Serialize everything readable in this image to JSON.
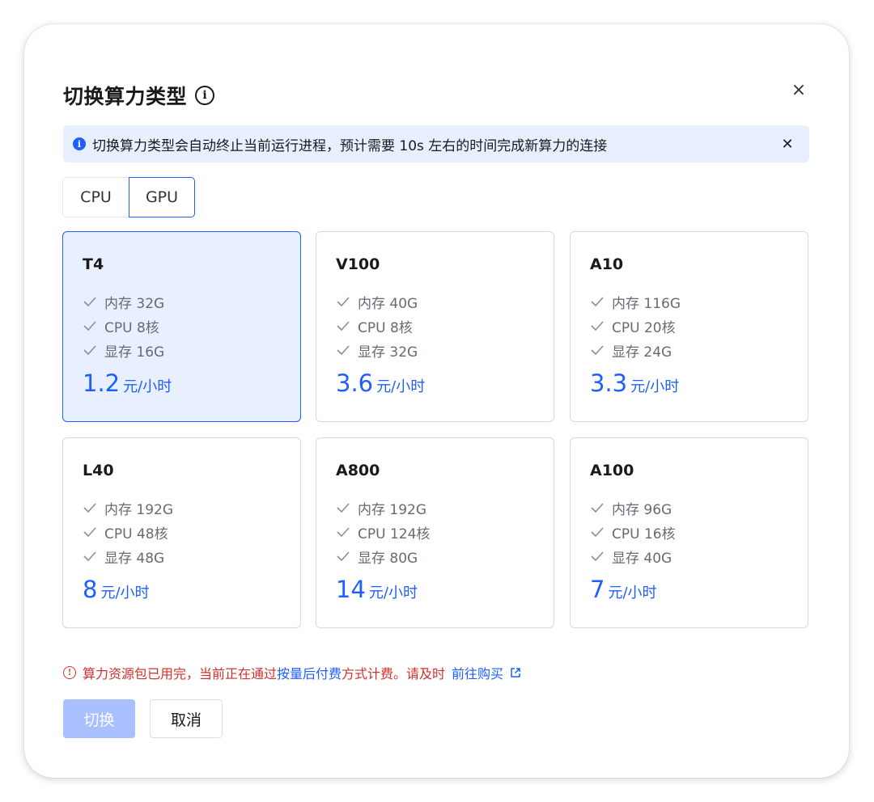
{
  "dialog": {
    "title": "切换算力类型",
    "info_glyph": "i",
    "close_glyph": "×"
  },
  "notice": {
    "icon_glyph": "i",
    "text": "切换算力类型会自动终止当前运行进程，预计需要 10s 左右的时间完成新算力的连接",
    "close_glyph": "✕"
  },
  "tabs": [
    {
      "label": "CPU",
      "active": false
    },
    {
      "label": "GPU",
      "active": true
    }
  ],
  "cards": [
    {
      "name": "T4",
      "specs": [
        "内存 32G",
        "CPU 8核",
        "显存 16G"
      ],
      "price": "1.2",
      "unit": "元/小时",
      "selected": true
    },
    {
      "name": "V100",
      "specs": [
        "内存 40G",
        "CPU 8核",
        "显存 32G"
      ],
      "price": "3.6",
      "unit": "元/小时",
      "selected": false
    },
    {
      "name": "A10",
      "specs": [
        "内存 116G",
        "CPU 20核",
        "显存 24G"
      ],
      "price": "3.3",
      "unit": "元/小时",
      "selected": false
    },
    {
      "name": "L40",
      "specs": [
        "内存 192G",
        "CPU 48核",
        "显存 48G"
      ],
      "price": "8",
      "unit": "元/小时",
      "selected": false
    },
    {
      "name": "A800",
      "specs": [
        "内存 192G",
        "CPU 124核",
        "显存 80G"
      ],
      "price": "14",
      "unit": "元/小时",
      "selected": false
    },
    {
      "name": "A100",
      "specs": [
        "内存 96G",
        "CPU 16核",
        "显存 40G"
      ],
      "price": "7",
      "unit": "元/小时",
      "selected": false
    }
  ],
  "warning": {
    "icon_glyph": "!",
    "part1": "算力资源包已用完，当前正在通过",
    "highlight": "按量后付费",
    "part2": "方式计费。请及时",
    "link": "前往购买"
  },
  "buttons": {
    "switch": "切换",
    "cancel": "取消"
  },
  "colors": {
    "accent": "#1f5eff",
    "selected_bg": "#e8efff",
    "warning": "#d0312d",
    "disabled_primary": "#a9bfff"
  }
}
